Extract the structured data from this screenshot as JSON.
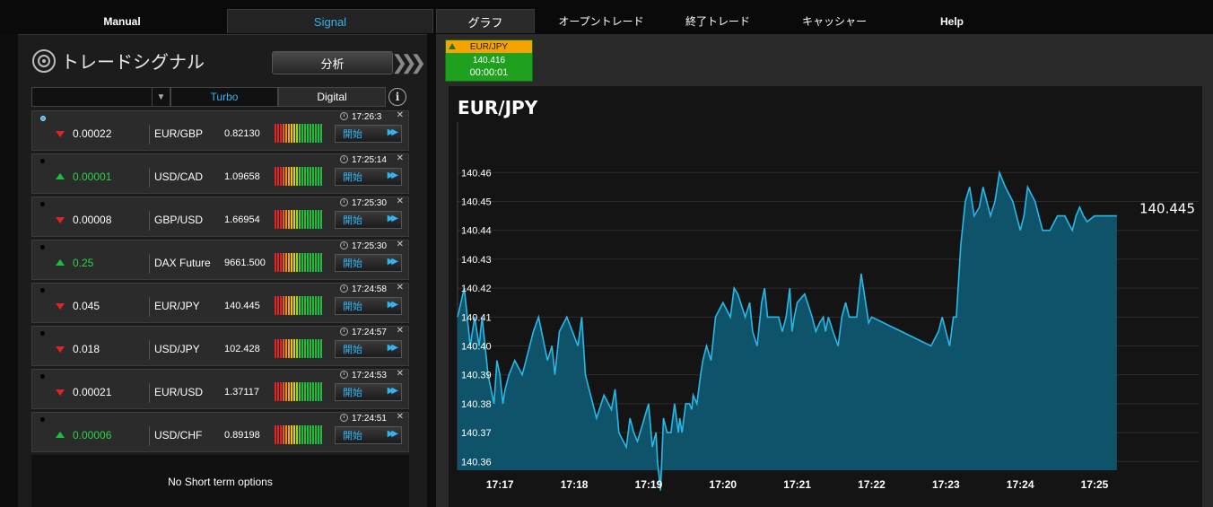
{
  "nav": {
    "tabs": [
      {
        "label": "Manual"
      },
      {
        "label": "Signal"
      },
      {
        "label": "グラフ"
      },
      {
        "label": "オープントレード"
      },
      {
        "label": "終了トレード"
      },
      {
        "label": "キャッシャー"
      },
      {
        "label": "Help"
      }
    ]
  },
  "signals_panel": {
    "title": "トレードシグナル",
    "analyze_label": "分析",
    "filter": {
      "selected": "",
      "turbo_label": "Turbo",
      "digital_label": "Digital"
    },
    "open_label": "開始",
    "no_options_text": "No Short term options",
    "rows": [
      {
        "active": true,
        "time": "17:26:3",
        "direction": "down",
        "strike": "0.00022",
        "pair": "EUR/GBP",
        "price": "0.82130"
      },
      {
        "active": false,
        "time": "17:25:14",
        "direction": "up",
        "strike": "0.00001",
        "pair": "USD/CAD",
        "price": "1.09658"
      },
      {
        "active": false,
        "time": "17:25:30",
        "direction": "down",
        "strike": "0.00008",
        "pair": "GBP/USD",
        "price": "1.66954"
      },
      {
        "active": false,
        "time": "17:25:30",
        "direction": "up",
        "strike": "0.25",
        "pair": "DAX Future",
        "price": "9661.500"
      },
      {
        "active": false,
        "time": "17:24:58",
        "direction": "down",
        "strike": "0.045",
        "pair": "EUR/JPY",
        "price": "140.445"
      },
      {
        "active": false,
        "time": "17:24:57",
        "direction": "down",
        "strike": "0.018",
        "pair": "USD/JPY",
        "price": "102.428"
      },
      {
        "active": false,
        "time": "17:24:53",
        "direction": "down",
        "strike": "0.00021",
        "pair": "EUR/USD",
        "price": "1.37117"
      },
      {
        "active": false,
        "time": "17:24:51",
        "direction": "up",
        "strike": "0.00006",
        "pair": "USD/CHF",
        "price": "0.89198"
      }
    ]
  },
  "asset_tile": {
    "pair": "EUR/JPY",
    "value": "140.416",
    "timer": "00:00:01"
  },
  "colors": {
    "accent": "#34b3f0",
    "up": "#19c13a",
    "down": "#e02424",
    "tile_green": "#1fa11f",
    "tile_orange": "#f6a200",
    "area_fill": "#0e5a74",
    "line": "#29b8e6"
  },
  "chart_data": {
    "type": "area",
    "title": "EUR/JPY",
    "last_value_label": "140.445",
    "ylim": [
      140.357,
      140.475
    ],
    "yticks": [
      "140.36",
      "140.37",
      "140.38",
      "140.39",
      "140.40",
      "140.41",
      "140.42",
      "140.43",
      "140.44",
      "140.45",
      "140.46"
    ],
    "xticks": [
      "17:17",
      "17:18",
      "17:19",
      "17:20",
      "17:21",
      "17:22",
      "17:23",
      "17:24",
      "17:25"
    ],
    "xlim": [
      16.43,
      26.4
    ],
    "grid": true,
    "series": [
      {
        "x": [
          16.43,
          16.52,
          16.6,
          16.66,
          16.72,
          16.76,
          16.8,
          16.84,
          16.88,
          16.92,
          16.96,
          17.0,
          17.04,
          17.07,
          17.12,
          17.2,
          17.3,
          17.4,
          17.45,
          17.52,
          17.6,
          17.64,
          17.7,
          17.74,
          17.78,
          17.8,
          17.9,
          18.05,
          18.1,
          18.15,
          18.2,
          18.3,
          18.4,
          18.5,
          18.55,
          18.6,
          18.7,
          18.75,
          18.8,
          18.85,
          18.92,
          19.0,
          19.05,
          19.1,
          19.12,
          19.16,
          19.2,
          19.25,
          19.3,
          19.35,
          19.4,
          19.42,
          19.45,
          19.5,
          19.55,
          19.58,
          19.6,
          19.65,
          19.7,
          19.73,
          19.78,
          19.84,
          19.9,
          20.0,
          20.1,
          20.15,
          20.2,
          20.3,
          20.36,
          20.4,
          20.46,
          20.52,
          20.56,
          20.6,
          20.65,
          20.7,
          20.75,
          20.8,
          20.85,
          20.9,
          20.93,
          20.96,
          21.0,
          21.1,
          21.2,
          21.25,
          21.3,
          21.35,
          21.38,
          21.42,
          21.48,
          21.55,
          21.6,
          21.65,
          21.7,
          21.8,
          21.86,
          21.92,
          21.96,
          22.0,
          22.4,
          22.8,
          22.9,
          22.95,
          23.0,
          23.05,
          23.1,
          23.14,
          23.2,
          23.26,
          23.32,
          23.38,
          23.45,
          23.5,
          23.55,
          23.6,
          23.66,
          23.72,
          23.8,
          23.9,
          24.0,
          24.05,
          24.1,
          24.2,
          24.3,
          24.4,
          24.5,
          24.6,
          24.64,
          24.7,
          24.75,
          24.8,
          24.85,
          24.9,
          25.0,
          25.3
        ],
        "values": [
          140.41,
          140.42,
          140.4,
          140.41,
          140.4,
          140.41,
          140.4,
          140.39,
          140.385,
          140.38,
          140.395,
          140.39,
          140.38,
          140.385,
          140.39,
          140.395,
          140.39,
          140.4,
          140.405,
          140.41,
          140.4,
          140.395,
          140.4,
          140.39,
          140.4,
          140.405,
          140.41,
          140.4,
          140.41,
          140.39,
          140.385,
          140.375,
          140.383,
          140.378,
          140.385,
          140.37,
          140.365,
          140.375,
          140.37,
          140.367,
          140.373,
          140.38,
          140.365,
          140.37,
          140.36,
          140.35,
          140.375,
          140.37,
          140.37,
          140.38,
          140.37,
          140.375,
          140.37,
          140.38,
          140.38,
          140.378,
          140.383,
          140.38,
          140.39,
          140.395,
          140.4,
          140.395,
          140.41,
          140.415,
          140.41,
          140.42,
          140.418,
          140.41,
          140.415,
          140.405,
          140.4,
          140.415,
          140.42,
          140.41,
          140.41,
          140.41,
          140.41,
          140.405,
          140.41,
          140.42,
          140.405,
          140.41,
          140.415,
          140.418,
          140.41,
          140.405,
          140.408,
          140.41,
          140.405,
          140.41,
          140.405,
          140.4,
          140.41,
          140.415,
          140.41,
          140.41,
          140.425,
          140.415,
          140.408,
          140.41,
          140.405,
          140.4,
          140.405,
          140.41,
          140.405,
          140.4,
          140.41,
          140.41,
          140.435,
          140.45,
          140.455,
          140.445,
          140.448,
          140.455,
          140.45,
          140.445,
          140.45,
          140.46,
          140.455,
          140.45,
          140.44,
          140.445,
          140.455,
          140.45,
          140.44,
          140.44,
          140.445,
          140.445,
          140.443,
          140.44,
          140.445,
          140.448,
          140.445,
          140.443,
          140.445,
          140.445
        ]
      }
    ]
  }
}
